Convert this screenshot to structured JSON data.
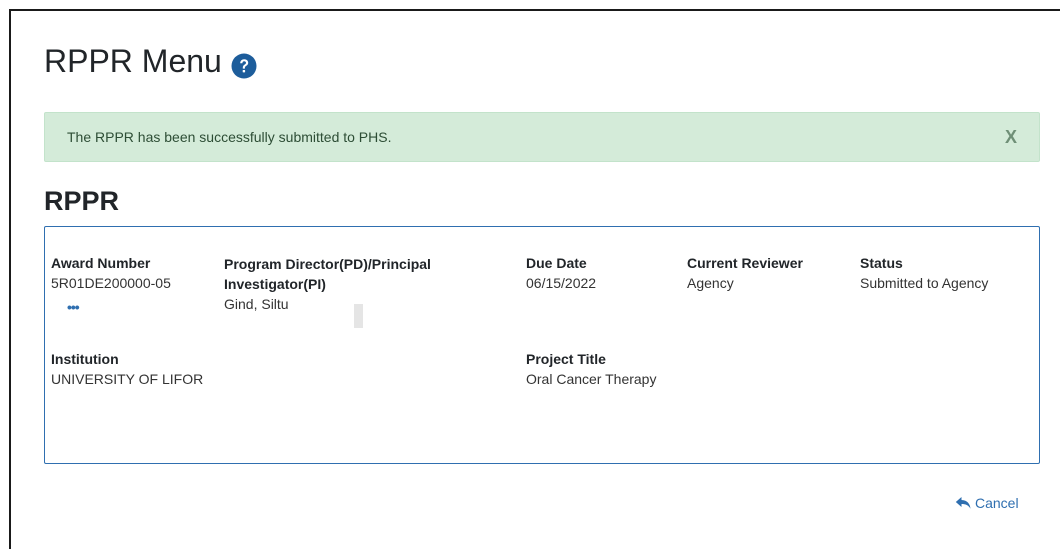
{
  "page": {
    "title": "RPPR Menu",
    "help_icon": "question-circle-icon"
  },
  "alert": {
    "message": "The RPPR has been successfully submitted to PHS.",
    "close_label": "X",
    "bg_color": "#d4ebd9"
  },
  "section": {
    "title": "RPPR"
  },
  "details": {
    "award_number": {
      "label": "Award Number",
      "value": "5R01DE200000-05",
      "more_label": "•••"
    },
    "pi": {
      "label_line1": "Program Director(PD)/Principal",
      "label_line2": "Investigator(PI)",
      "value": "Gind, Siltu"
    },
    "due_date": {
      "label": "Due Date",
      "value": "06/15/2022"
    },
    "current_reviewer": {
      "label": "Current Reviewer",
      "value": "Agency"
    },
    "status": {
      "label": "Status",
      "value": "Submitted to Agency"
    },
    "institution": {
      "label": "Institution",
      "value": "UNIVERSITY OF LIFOR"
    },
    "project_title": {
      "label": "Project Title",
      "value": "Oral Cancer Therapy"
    }
  },
  "actions": {
    "cancel_label": "Cancel",
    "cancel_icon": "reply-icon",
    "link_color": "#2f6fb0"
  }
}
